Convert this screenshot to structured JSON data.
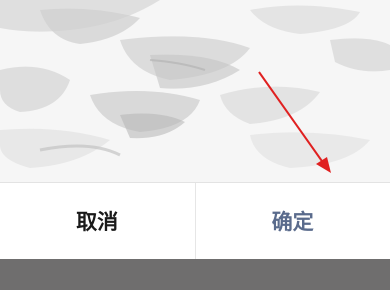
{
  "dialog": {
    "image_icon": "ink-wash-painting",
    "buttons": {
      "cancel_label": "取消",
      "confirm_label": "确定"
    }
  },
  "colors": {
    "cancel_text": "#1a1a1a",
    "confirm_text": "#5a6b8c",
    "overlay": "#6f6e6e",
    "annotation_arrow": "#e02020"
  }
}
